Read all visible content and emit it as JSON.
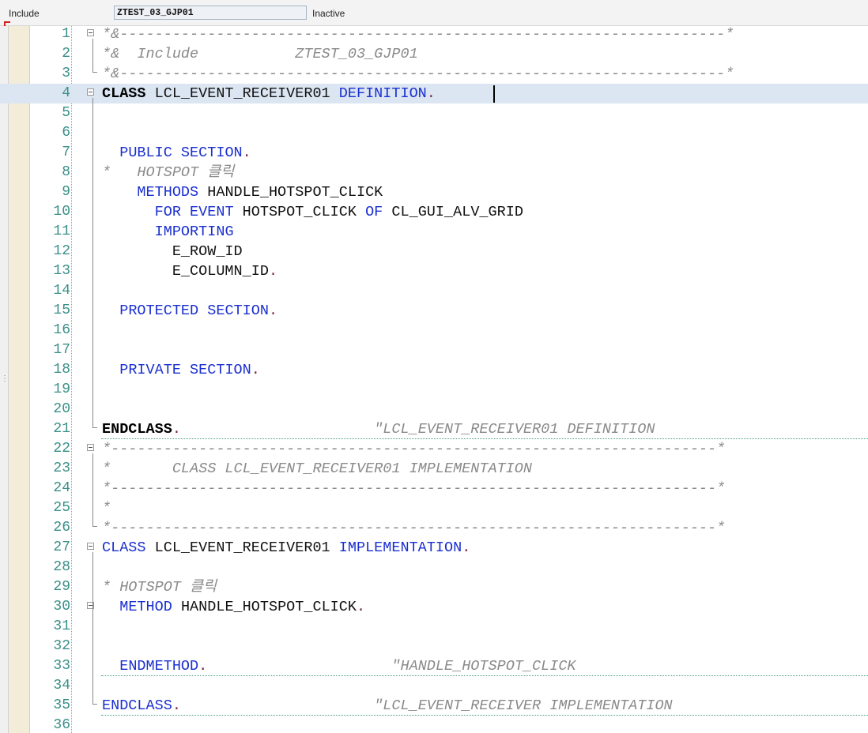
{
  "header": {
    "type_label": "Include",
    "program_name": "ZTEST_03_GJP01",
    "status": "Inactive"
  },
  "colors": {
    "keyword": "#1a2fd0",
    "comment": "#8a8a8a",
    "line_number": "#3a8f88",
    "highlight_row": "#dbe6f2",
    "period": "#7a1f4b"
  },
  "editor": {
    "lines": [
      {
        "n": "1",
        "fold": true,
        "parts": [
          [
            "cm",
            "*&---------------------------------------------------------------------*"
          ]
        ]
      },
      {
        "n": "2",
        "parts": [
          [
            "cm",
            "*&  Include           ZTEST_03_GJP01"
          ]
        ]
      },
      {
        "n": "3",
        "parts": [
          [
            "cm",
            "*&---------------------------------------------------------------------*"
          ]
        ]
      },
      {
        "n": "4",
        "fold": true,
        "hl": true,
        "parts": [
          [
            "kwb",
            "CLASS"
          ],
          [
            "id",
            " LCL_EVENT_RECEIVER01 "
          ],
          [
            "kw",
            "DEFINITION"
          ],
          [
            "pt",
            "."
          ]
        ]
      },
      {
        "n": "5",
        "parts": []
      },
      {
        "n": "6",
        "parts": []
      },
      {
        "n": "7",
        "parts": [
          [
            "id",
            "  "
          ],
          [
            "kw",
            "PUBLIC SECTION"
          ],
          [
            "pt",
            "."
          ]
        ]
      },
      {
        "n": "8",
        "parts": [
          [
            "cm",
            "*   HOTSPOT 클릭"
          ]
        ]
      },
      {
        "n": "9",
        "parts": [
          [
            "id",
            "    "
          ],
          [
            "kw",
            "METHODS"
          ],
          [
            "id",
            " HANDLE_HOTSPOT_CLICK"
          ]
        ]
      },
      {
        "n": "10",
        "parts": [
          [
            "id",
            "      "
          ],
          [
            "kw",
            "FOR EVENT"
          ],
          [
            "id",
            " HOTSPOT_CLICK "
          ],
          [
            "kw",
            "OF"
          ],
          [
            "id",
            " CL_GUI_ALV_GRID"
          ]
        ]
      },
      {
        "n": "11",
        "parts": [
          [
            "id",
            "      "
          ],
          [
            "kw",
            "IMPORTING"
          ]
        ]
      },
      {
        "n": "12",
        "parts": [
          [
            "id",
            "        E_ROW_ID"
          ]
        ]
      },
      {
        "n": "13",
        "parts": [
          [
            "id",
            "        E_COLUMN_ID"
          ],
          [
            "pt",
            "."
          ]
        ]
      },
      {
        "n": "14",
        "parts": []
      },
      {
        "n": "15",
        "parts": [
          [
            "id",
            "  "
          ],
          [
            "kw",
            "PROTECTED SECTION"
          ],
          [
            "pt",
            "."
          ]
        ]
      },
      {
        "n": "16",
        "parts": []
      },
      {
        "n": "17",
        "parts": []
      },
      {
        "n": "18",
        "parts": [
          [
            "id",
            "  "
          ],
          [
            "kw",
            "PRIVATE SECTION"
          ],
          [
            "pt",
            "."
          ]
        ]
      },
      {
        "n": "19",
        "parts": []
      },
      {
        "n": "20",
        "parts": []
      },
      {
        "n": "21",
        "dots": true,
        "parts": [
          [
            "kwb",
            "ENDCLASS"
          ],
          [
            "pt",
            "."
          ],
          [
            "id",
            "                      "
          ],
          [
            "cm",
            "\"LCL_EVENT_RECEIVER01 DEFINITION"
          ]
        ]
      },
      {
        "n": "22",
        "fold": true,
        "parts": [
          [
            "cm",
            "*---------------------------------------------------------------------*"
          ]
        ]
      },
      {
        "n": "23",
        "parts": [
          [
            "cm",
            "*       CLASS LCL_EVENT_RECEIVER01 IMPLEMENTATION"
          ]
        ]
      },
      {
        "n": "24",
        "parts": [
          [
            "cm",
            "*---------------------------------------------------------------------*"
          ]
        ]
      },
      {
        "n": "25",
        "parts": [
          [
            "cm",
            "*"
          ]
        ]
      },
      {
        "n": "26",
        "parts": [
          [
            "cm",
            "*---------------------------------------------------------------------*"
          ]
        ]
      },
      {
        "n": "27",
        "fold": true,
        "parts": [
          [
            "kw",
            "CLASS"
          ],
          [
            "id",
            " LCL_EVENT_RECEIVER01 "
          ],
          [
            "kw",
            "IMPLEMENTATION"
          ],
          [
            "pt",
            "."
          ]
        ]
      },
      {
        "n": "28",
        "parts": []
      },
      {
        "n": "29",
        "parts": [
          [
            "cm",
            "* HOTSPOT 클릭"
          ]
        ]
      },
      {
        "n": "30",
        "fold": true,
        "parts": [
          [
            "id",
            "  "
          ],
          [
            "kw",
            "METHOD"
          ],
          [
            "id",
            " HANDLE_HOTSPOT_CLICK"
          ],
          [
            "pt",
            "."
          ]
        ]
      },
      {
        "n": "31",
        "parts": []
      },
      {
        "n": "32",
        "parts": []
      },
      {
        "n": "33",
        "dots": true,
        "parts": [
          [
            "id",
            "  "
          ],
          [
            "kw",
            "ENDMETHOD"
          ],
          [
            "pt",
            "."
          ],
          [
            "id",
            "                     "
          ],
          [
            "cm",
            "\"HANDLE_HOTSPOT_CLICK"
          ]
        ]
      },
      {
        "n": "34",
        "parts": []
      },
      {
        "n": "35",
        "dots": true,
        "parts": [
          [
            "kw",
            "ENDCLASS"
          ],
          [
            "pt",
            "."
          ],
          [
            "id",
            "                      "
          ],
          [
            "cm",
            "\"LCL_EVENT_RECEIVER IMPLEMENTATION"
          ]
        ]
      },
      {
        "n": "36",
        "parts": []
      }
    ]
  }
}
